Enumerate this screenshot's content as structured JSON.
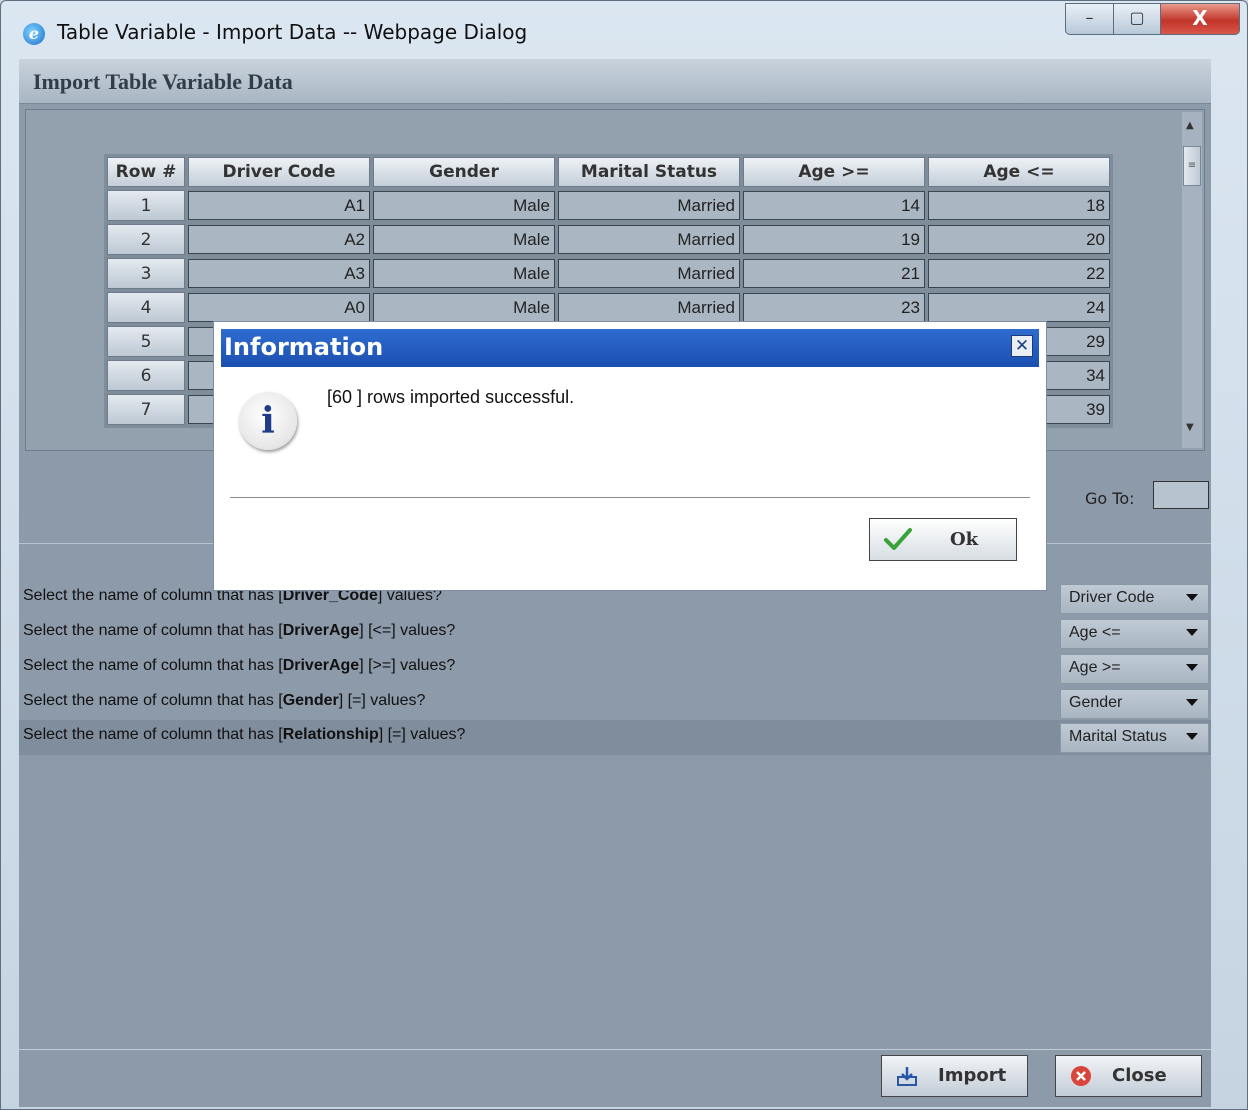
{
  "window": {
    "title": "Table Variable - Import Data -- Webpage Dialog",
    "app_icon": "ie-icon",
    "controls": {
      "minimize": "–",
      "maximize": "▢",
      "close": "X"
    }
  },
  "panel": {
    "title": "Import Table Variable Data"
  },
  "grid": {
    "headers": [
      "Row #",
      "Driver Code",
      "Gender",
      "Marital Status",
      "Age >=",
      "Age <="
    ],
    "rows": [
      {
        "n": "1",
        "code": "A1",
        "gender": "Male",
        "marital": "Married",
        "age_min": "14",
        "age_max": "18"
      },
      {
        "n": "2",
        "code": "A2",
        "gender": "Male",
        "marital": "Married",
        "age_min": "19",
        "age_max": "20"
      },
      {
        "n": "3",
        "code": "A3",
        "gender": "Male",
        "marital": "Married",
        "age_min": "21",
        "age_max": "22"
      },
      {
        "n": "4",
        "code": "A0",
        "gender": "Male",
        "marital": "Married",
        "age_min": "23",
        "age_max": "24"
      },
      {
        "n": "5",
        "code": "",
        "gender": "",
        "marital": "",
        "age_min": "",
        "age_max": "29"
      },
      {
        "n": "6",
        "code": "",
        "gender": "",
        "marital": "",
        "age_min": "",
        "age_max": "34"
      },
      {
        "n": "7",
        "code": "",
        "gender": "",
        "marital": "",
        "age_min": "",
        "age_max": "39"
      }
    ]
  },
  "pager": {
    "goto_label": "Go To:",
    "goto_value": ""
  },
  "mappings": [
    {
      "prefix": "Select the name of column that has [",
      "field": "Driver_Code",
      "suffix": "] values?",
      "selected": "Driver Code"
    },
    {
      "prefix": "Select the name of column that has [",
      "field": "DriverAge",
      "suffix": "] [<=] values?",
      "selected": "Age <="
    },
    {
      "prefix": "Select the name of column that has [",
      "field": "DriverAge",
      "suffix": "] [>=] values?",
      "selected": "Age >="
    },
    {
      "prefix": "Select the name of column that has [",
      "field": "Gender",
      "suffix": "] [=] values?",
      "selected": "Gender"
    },
    {
      "prefix": "Select the name of column that has [",
      "field": "Relationship",
      "suffix": "] [=] values?",
      "selected": "Marital Status"
    }
  ],
  "footer": {
    "import_label": "Import",
    "close_label": "Close"
  },
  "modal": {
    "title": "Information",
    "close_glyph": "✕",
    "icon_glyph": "i",
    "message": "[60 ] rows imported successful.",
    "ok_label": "Ok"
  },
  "colors": {
    "modal_title": "#1b4fb0",
    "panel_bg": "#8d9aa9",
    "selected_row": "#7f8d9c"
  }
}
